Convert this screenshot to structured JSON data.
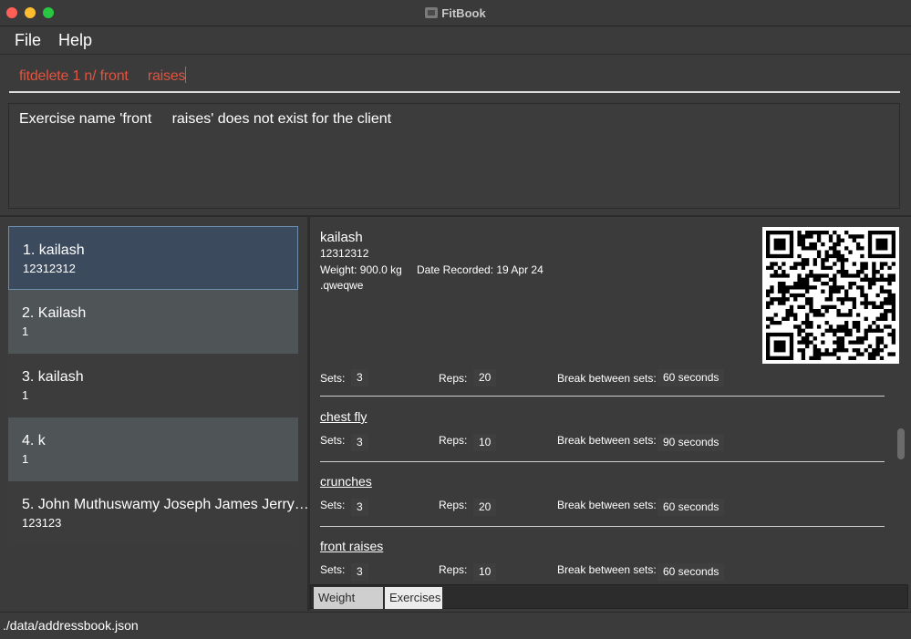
{
  "window": {
    "title": "FitBook"
  },
  "menu": {
    "file": "File",
    "help": "Help"
  },
  "command": {
    "value": "fitdelete 1 n/ front     raises"
  },
  "result": {
    "message": "Exercise name 'front     raises' does not exist for the client"
  },
  "clients": [
    {
      "name": "1. kailash",
      "phone": "12312312"
    },
    {
      "name": "2. Kailash",
      "phone": "1"
    },
    {
      "name": "3. kailash",
      "phone": "1"
    },
    {
      "name": "4. k",
      "phone": "1"
    },
    {
      "name": "5. John Muthuswamy Joseph James Jerry…",
      "phone": "123123"
    }
  ],
  "details": {
    "name": "kailash",
    "phone": "12312312",
    "weight": "Weight: 900.0 kg",
    "date": "Date Recorded: 19 Apr 24",
    "note": ".qweqwe",
    "labels": {
      "sets": "Sets:",
      "reps": "Reps:",
      "break": "Break between sets:"
    },
    "exercises": [
      {
        "name": "",
        "sets": "3",
        "reps": "20",
        "break": "60 seconds"
      },
      {
        "name": "chest fly",
        "sets": "3",
        "reps": "10",
        "break": "90 seconds"
      },
      {
        "name": "crunches",
        "sets": "3",
        "reps": "20",
        "break": "60 seconds"
      },
      {
        "name": "front raises",
        "sets": "3",
        "reps": "10",
        "break": "60 seconds"
      }
    ]
  },
  "tabs": {
    "weight": "Weight (kg)",
    "exercises": "Exercises"
  },
  "status": {
    "path": "./data/addressbook.json"
  },
  "colors": {
    "command_text": "#e1533e",
    "selected_card": "#3c4a5e"
  }
}
